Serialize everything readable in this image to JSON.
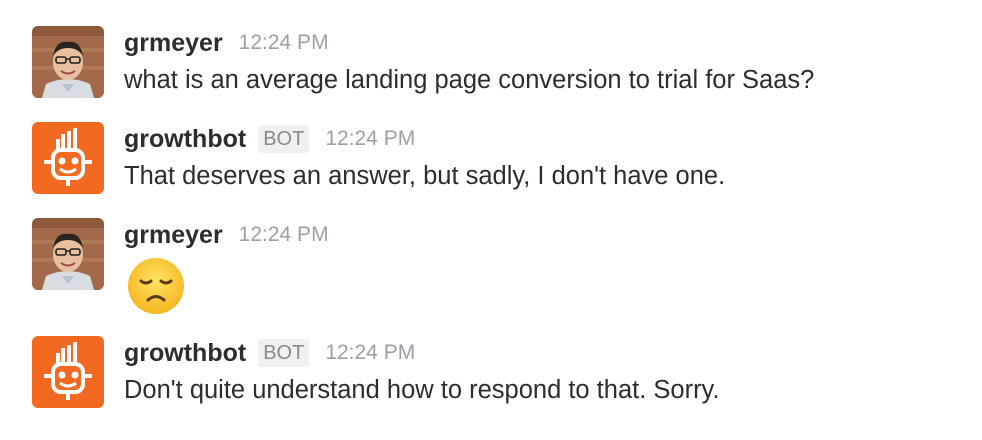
{
  "messages": [
    {
      "name": "grmeyer",
      "time": "12:24 PM",
      "text": "what is an average landing page conversion to trial for Saas?"
    },
    {
      "name": "growthbot",
      "badge": "BOT",
      "time": "12:24 PM",
      "text": "That deserves an answer, but sadly, I don't have one."
    },
    {
      "name": "grmeyer",
      "time": "12:24 PM",
      "emoji": "disappointed-face-icon"
    },
    {
      "name": "growthbot",
      "badge": "BOT",
      "time": "12:24 PM",
      "text": "Don't quite understand how to respond to that. Sorry."
    }
  ],
  "colors": {
    "bot_brand": "#f26a21",
    "username": "#2c2d30",
    "timestamp": "#9e9ea6"
  }
}
